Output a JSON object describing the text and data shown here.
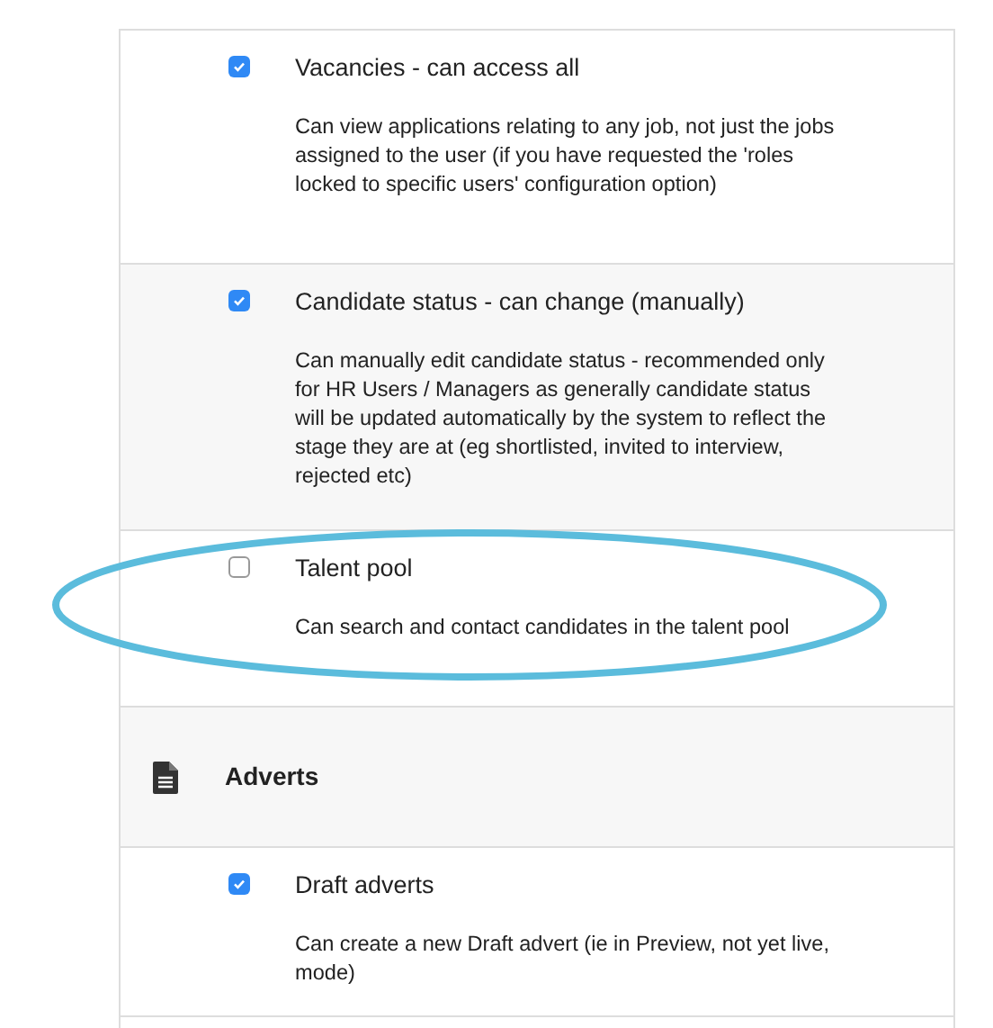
{
  "rows": [
    {
      "kind": "permission",
      "title": "Vacancies - can access all",
      "description": "Can view applications relating to any job, not just the jobs assigned to the user (if you have requested the 'roles locked to specific users' configuration option)",
      "checked": true,
      "highlighted": false
    },
    {
      "kind": "permission",
      "title": "Candidate status - can change (manually)",
      "description": "Can manually edit candidate status - recommended only for HR Users / Managers as generally candidate status will be updated automatically by the system to reflect the stage they are at (eg shortlisted, invited to interview, rejected etc)",
      "checked": true,
      "highlighted": false
    },
    {
      "kind": "permission",
      "title": "Talent pool",
      "description": "Can search and contact candidates in the talent pool",
      "checked": false,
      "highlighted": true
    },
    {
      "kind": "section",
      "title": "Adverts"
    },
    {
      "kind": "permission",
      "title": "Draft adverts",
      "description": "Can create a new Draft advert (ie in Preview, not yet live, mode)",
      "checked": true,
      "highlighted": false
    }
  ]
}
